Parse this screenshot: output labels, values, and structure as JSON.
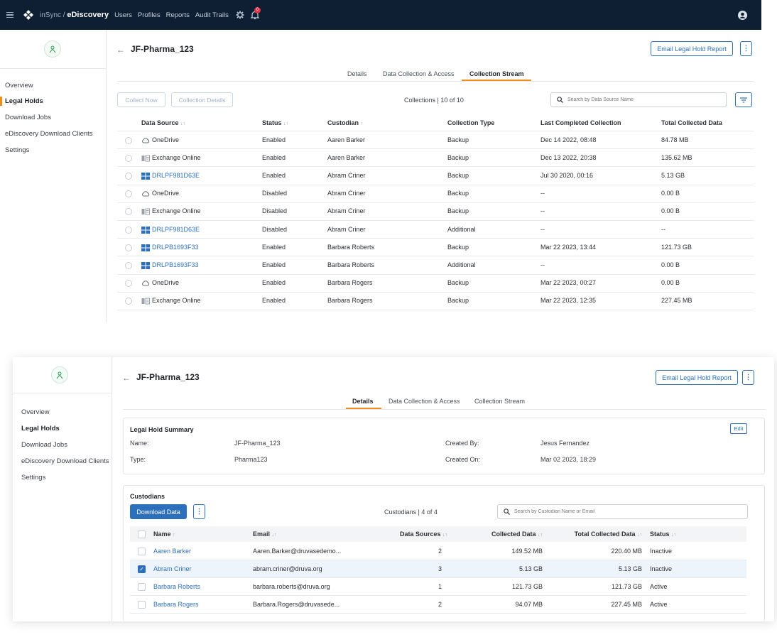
{
  "topnav": {
    "brand_prefix": "inSync / ",
    "brand_name": "eDiscovery",
    "links": [
      "Users",
      "Profiles",
      "Reports",
      "Audit Trails"
    ],
    "notification_count": "0"
  },
  "sidebar": {
    "items": [
      "Overview",
      "Legal Holds",
      "Download Jobs",
      "eDiscovery Download Clients",
      "Settings"
    ],
    "active": "Legal Holds"
  },
  "header": {
    "back": "←",
    "title": "JF-Pharma_123",
    "report_button": "Email Legal Hold Report",
    "more": "⋮"
  },
  "tabs": [
    "Details",
    "Data Collection & Access",
    "Collection Stream"
  ],
  "panel1": {
    "active_tab": "Collection Stream",
    "buttons": {
      "collect_now": "Collect Now",
      "collection_details": "Collection Details"
    },
    "counter": "Collections | 10 of 10",
    "search_placeholder": "Search by Data Source Name",
    "columns": [
      "Data Source",
      "Status",
      "Custodian",
      "Collection Type",
      "Last Completed Collection",
      "Total Collected Data"
    ],
    "sort_marks": [
      "↓↑",
      "↓↑",
      "↑"
    ],
    "rows": [
      {
        "icon": "cloud-icon",
        "source": "OneDrive",
        "link": false,
        "status": "Enabled",
        "custodian": "Aaren Barker",
        "type": "Backup",
        "last": "Dec 14 2022, 08:48",
        "total": "84.78 MB"
      },
      {
        "icon": "exchange-icon",
        "source": "Exchange Online",
        "link": false,
        "status": "Enabled",
        "custodian": "Aaren Barker",
        "type": "Backup",
        "last": "Dec 13 2022, 20:38",
        "total": "135.62 MB"
      },
      {
        "icon": "windows-icon",
        "source": "DRLPF981D63E",
        "link": true,
        "status": "Enabled",
        "custodian": "Abram Criner",
        "type": "Backup",
        "last": "Jul 30 2020, 00:16",
        "total": "5.13 GB"
      },
      {
        "icon": "cloud-icon",
        "source": "OneDrive",
        "link": false,
        "status": "Disabled",
        "custodian": "Abram Criner",
        "type": "Backup",
        "last": "--",
        "total": "0.00 B"
      },
      {
        "icon": "exchange-icon",
        "source": "Exchange Online",
        "link": false,
        "status": "Disabled",
        "custodian": "Abram Criner",
        "type": "Backup",
        "last": "--",
        "total": "0.00 B"
      },
      {
        "icon": "windows-icon",
        "source": "DRLPF981D63E",
        "link": true,
        "status": "Disabled",
        "custodian": "Abram Criner",
        "type": "Additional",
        "last": "--",
        "total": "--"
      },
      {
        "icon": "windows-icon",
        "source": "DRLPB1693F33",
        "link": true,
        "status": "Enabled",
        "custodian": "Barbara Roberts",
        "type": "Backup",
        "last": "Mar 22 2023, 13:44",
        "total": "121.73 GB"
      },
      {
        "icon": "windows-icon",
        "source": "DRLPB1693F33",
        "link": true,
        "status": "Enabled",
        "custodian": "Barbara Roberts",
        "type": "Additional",
        "last": "--",
        "total": "0.00 B"
      },
      {
        "icon": "cloud-icon",
        "source": "OneDrive",
        "link": false,
        "status": "Enabled",
        "custodian": "Barbara Rogers",
        "type": "Backup",
        "last": "Mar 22 2023, 00:27",
        "total": "0.00 B"
      },
      {
        "icon": "exchange-icon",
        "source": "Exchange Online",
        "link": false,
        "status": "Enabled",
        "custodian": "Barbara Rogers",
        "type": "Backup",
        "last": "Mar 22 2023, 12:35",
        "total": "227.45 MB"
      }
    ]
  },
  "panel2": {
    "active_tab": "Details",
    "summary": {
      "title": "Legal Hold Summary",
      "edit": "Edit",
      "name_label": "Name:",
      "name_value": "JF-Pharma_123",
      "type_label": "Type:",
      "type_value": "Pharma123",
      "created_by_label": "Created By:",
      "created_by_value": "Jesus Fernandez",
      "created_on_label": "Created On:",
      "created_on_value": "Mar 02 2023, 18:29"
    },
    "custodians": {
      "title": "Custodians",
      "download_button": "Download Data",
      "more": "⋮",
      "counter": "Custodians | 4 of 4",
      "search_placeholder": "Search by Custodian Name or Email",
      "columns": [
        "Name",
        "Email",
        "Data Sources",
        "Collected Data",
        "Total Collected Data",
        "Status"
      ],
      "sort_marks": [
        "↑",
        "↓↑",
        "↓↑",
        "↓↑",
        "↓↑",
        "↓↑"
      ],
      "rows": [
        {
          "name": "Aaren Barker",
          "email": "Aaren.Barker@druvasedemo...",
          "sources": "2",
          "collected": "149.52 MB",
          "total": "220.40 MB",
          "status": "Inactive",
          "checked": false
        },
        {
          "name": "Abram Criner",
          "email": "abram.criner@druva.org",
          "sources": "3",
          "collected": "5.13 GB",
          "total": "5.13 GB",
          "status": "Inactive",
          "checked": true
        },
        {
          "name": "Barbara Roberts",
          "email": "barbara.roberts@druva.org",
          "sources": "1",
          "collected": "121.73 GB",
          "total": "121.73 GB",
          "status": "Active",
          "checked": false
        },
        {
          "name": "Barbara Rogers",
          "email": "Barbara.Rogers@druvasede...",
          "sources": "2",
          "collected": "94.07 MB",
          "total": "227.45 MB",
          "status": "Active",
          "checked": false
        }
      ]
    }
  },
  "colors": {
    "nav_bg": "#0e1f33",
    "accent": "#f08c1a",
    "link": "#2c6fbb"
  }
}
